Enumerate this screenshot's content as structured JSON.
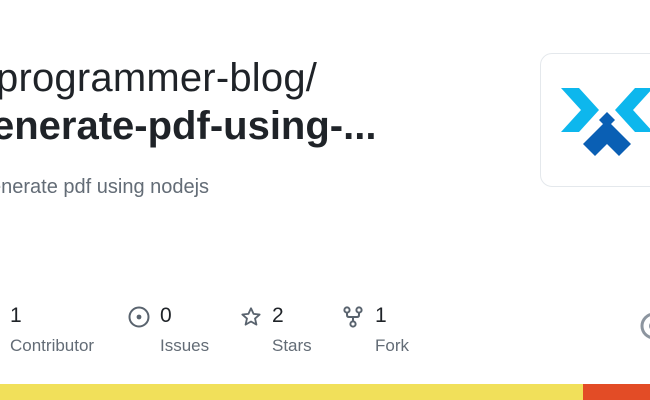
{
  "repo": {
    "owner": "programmer-blog/",
    "name": "enerate-pdf-using-...",
    "description": "enerate pdf using nodejs"
  },
  "stats": [
    {
      "value": "1",
      "label": "Contributor",
      "icon": "people-icon"
    },
    {
      "value": "0",
      "label": "Issues",
      "icon": "issue-opened-icon"
    },
    {
      "value": "2",
      "label": "Stars",
      "icon": "star-icon"
    },
    {
      "value": "1",
      "label": "Fork",
      "icon": "repo-forked-icon"
    }
  ],
  "logo": {
    "icon": "blue-x-chevron-logo",
    "colors": [
      "#0db7ed",
      "#0a5fb4"
    ]
  },
  "language_bar": [
    {
      "color": "#f1e05a",
      "share": 0.897
    },
    {
      "color": "#e34c26",
      "share": 0.103
    }
  ],
  "colors": {
    "text_primary": "#1f2328",
    "text_muted": "#636c76",
    "icon_muted": "#59636e"
  }
}
